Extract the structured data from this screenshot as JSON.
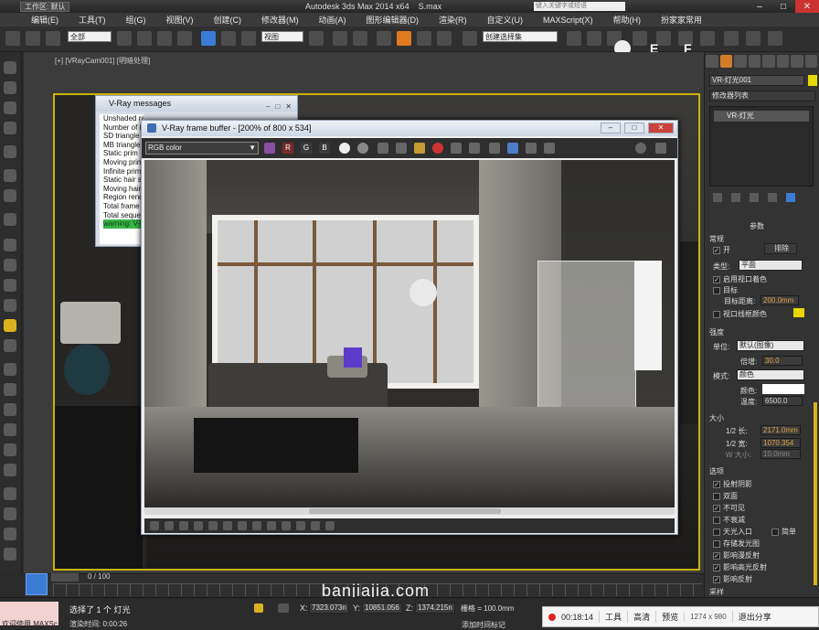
{
  "app": {
    "workspace": "工作区: 默认",
    "title": "Autodesk 3ds Max  2014 x64",
    "file": "S.max",
    "search_placeholder": "键入关键字或短语"
  },
  "menu": [
    "编辑(E)",
    "工具(T)",
    "组(G)",
    "视图(V)",
    "创建(C)",
    "修改器(M)",
    "动画(A)",
    "图形编辑器(D)",
    "渲染(R)",
    "自定义(U)",
    "MAXScript(X)",
    "帮助(H)",
    "扮家家常用"
  ],
  "toolbar": {
    "selection_filter": "全部",
    "ref_coord": "视图",
    "named_sel_placeholder": "创建选择集",
    "letters": [
      "E",
      "F"
    ]
  },
  "viewport": {
    "label": "[+] [VRayCam001] [明暗处理]"
  },
  "vray_messages": {
    "title": "V-Ray messages",
    "lines": [
      "Unshaded rays: 0",
      "Number of inte",
      "SD triangle",
      "MB triangle",
      "Static prim",
      "Moving prim",
      "Infinite prim",
      "Static hair s",
      "Moving hair",
      "Region rende",
      "Total frame ti",
      "Total sequen"
    ],
    "warning": "warning: V-Ray"
  },
  "frame_buffer": {
    "title": "V-Ray frame buffer - [200% of 800 x 534]",
    "channel": "RGB color",
    "channel_buttons": [
      "R",
      "G",
      "B"
    ]
  },
  "command_panel": {
    "object_name": "VR-灯光001",
    "modifier_list": "修改器列表",
    "stack_item": "VR-灯光",
    "rollout_params": "参数",
    "general": "常规",
    "on_label": "开",
    "exclude_label": "排除",
    "type_label": "类型:",
    "type_value": "平面",
    "enable_viewport_shading": "启用视口着色",
    "target": "目标",
    "target_distance_label": "目标距离:",
    "target_distance": "200.0mm",
    "viewport_wire_color": "视口线框颜色",
    "intensity": "强度",
    "units_label": "单位:",
    "units_value": "默认(图像)",
    "multiplier_label": "倍增:",
    "multiplier": "30.0",
    "mode_label": "模式:",
    "mode_value": "颜色",
    "color_label": "颜色:",
    "temperature_label": "温度:",
    "temperature": "6500.0",
    "size": "大小",
    "half_length_label": "1/2 长:",
    "half_length": "2171.0mm",
    "half_width_label": "1/2 宽:",
    "half_width": "1070.354",
    "w_size_label": "W 大小:",
    "w_size": "10.0mm",
    "options": "选项",
    "opts": [
      {
        "label": "投射阴影",
        "checked": true
      },
      {
        "label": "双面",
        "checked": false
      },
      {
        "label": "不可见",
        "checked": true
      },
      {
        "label": "不衰减",
        "checked": false
      },
      {
        "label": "天光入口",
        "checked": false
      },
      {
        "label": "存储发光图",
        "checked": false
      },
      {
        "label": "影响漫反射",
        "checked": true
      },
      {
        "label": "影响高光反射",
        "checked": true
      },
      {
        "label": "影响反射",
        "checked": true
      }
    ],
    "simple_label": "简单",
    "sampling": "采样",
    "wire_color": "#e8d800"
  },
  "timeline": {
    "frame_counter": "0 / 100"
  },
  "status": {
    "selected": "选择了 1 个 灯光",
    "render_time": "渲染时间: 0:00:26",
    "welcome": "欢迎使用 MAXSc",
    "x_label": "X:",
    "x_value": "7323.073n",
    "y_label": "Y:",
    "y_value": "10851.056",
    "z_label": "Z:",
    "z_value": "1374.215n",
    "grid": "栅格 = 100.0mm",
    "add_tag": "添加时间标记"
  },
  "watermark": "banjiajia.com",
  "recorder": {
    "time": "00:18:14",
    "tools": "工具",
    "quality": "高清",
    "preview": "预览",
    "resolution": "1274 x 980",
    "exit": "退出分享"
  }
}
